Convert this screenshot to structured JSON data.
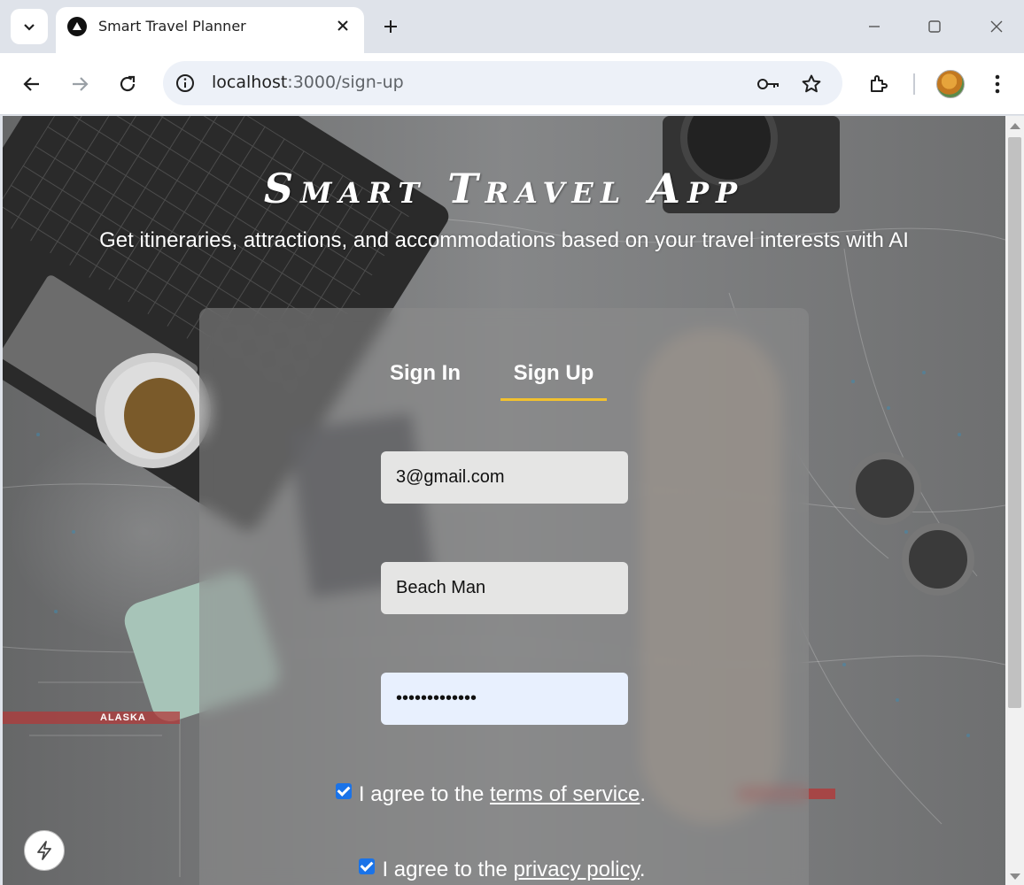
{
  "browser": {
    "tab_title": "Smart Travel Planner",
    "url_host": "localhost",
    "url_path": ":3000/sign-up"
  },
  "page": {
    "title": "Smart Travel App",
    "subtitle": "Get itineraries, attractions, and accommodations based on your travel interests with AI"
  },
  "auth": {
    "tabs": [
      {
        "label": "Sign In",
        "active": false
      },
      {
        "label": "Sign Up",
        "active": true
      }
    ],
    "email_value": "3@gmail.com",
    "name_value": "Beach Man",
    "password_value": "•••••••••••••",
    "terms": {
      "prefix": "I agree to the ",
      "link": "terms of service",
      "suffix": ".",
      "checked": true
    },
    "privacy": {
      "prefix": "I agree to the ",
      "link": "privacy policy",
      "suffix": ".",
      "checked": true
    }
  },
  "background": {
    "map_label": "ALASKA"
  },
  "colors": {
    "accent": "#f2c12e",
    "checkbox": "#1a73e8"
  }
}
